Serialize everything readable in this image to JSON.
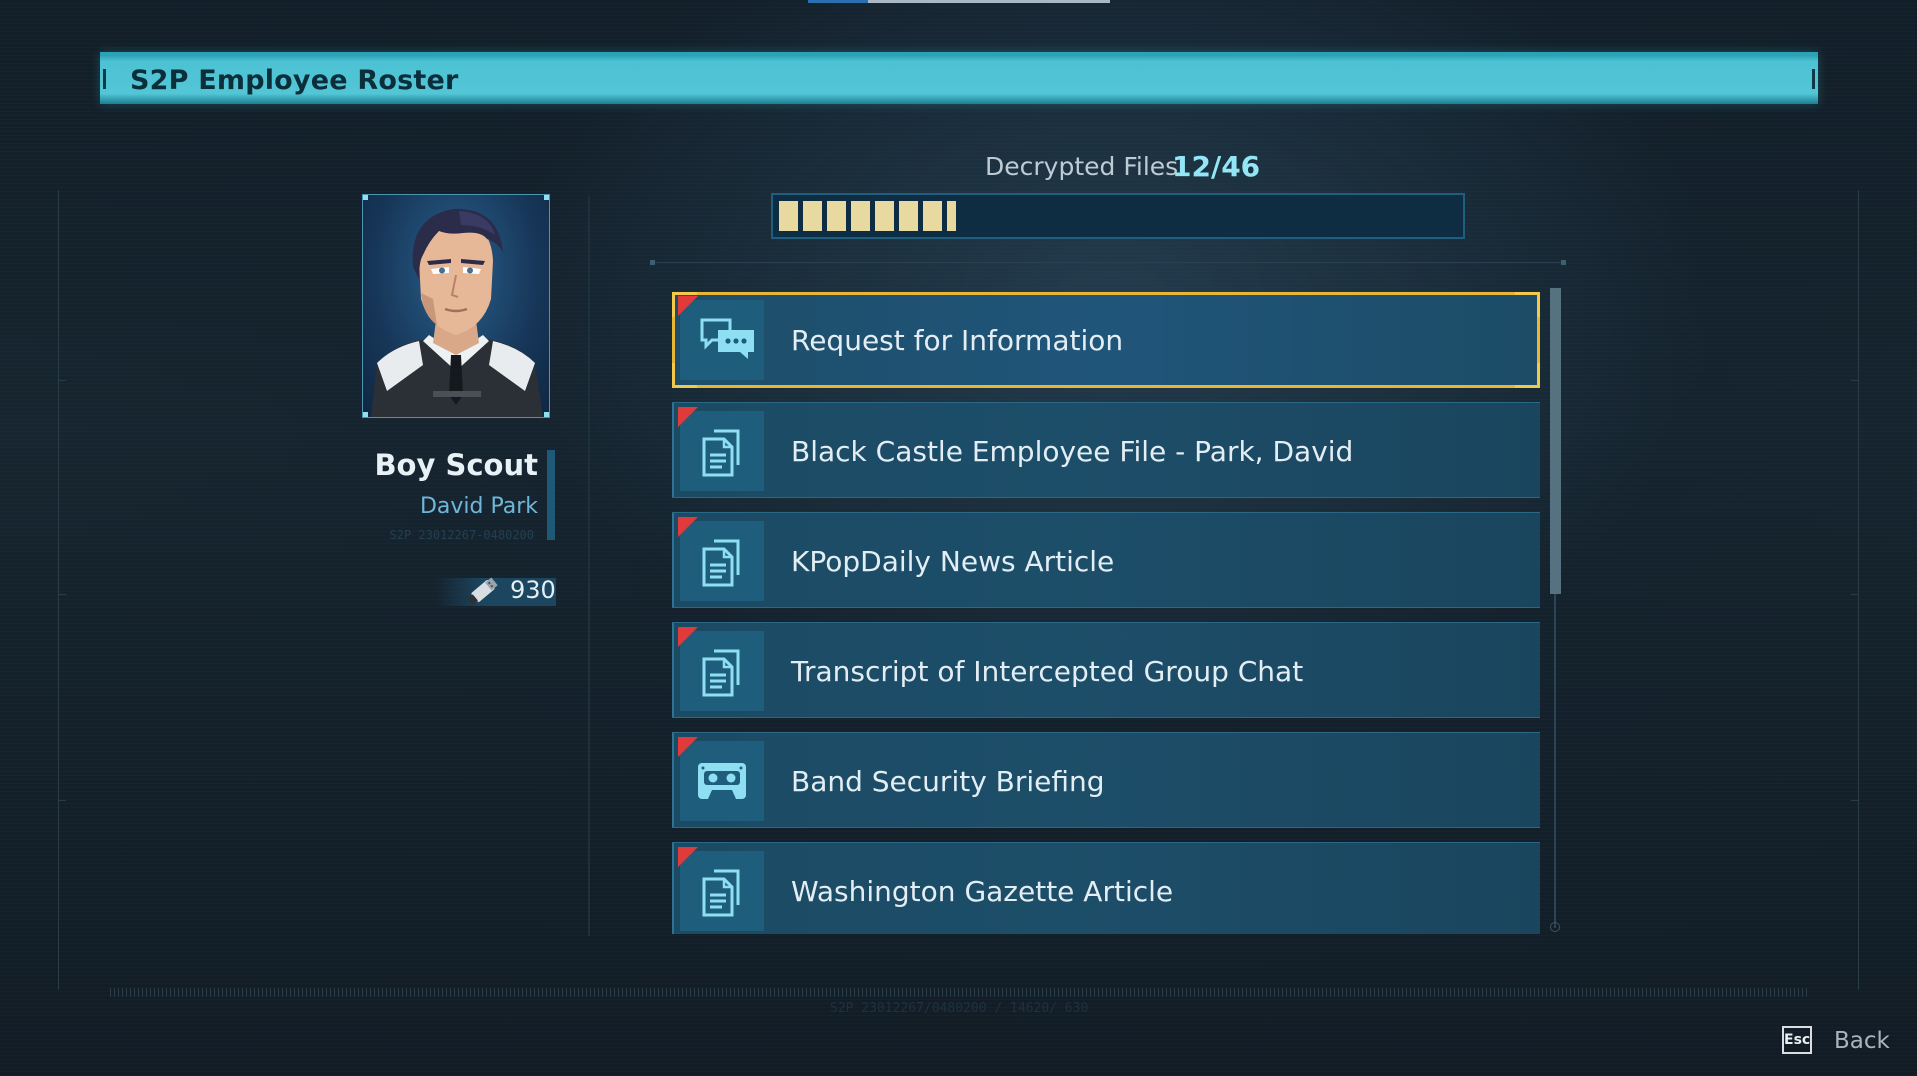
{
  "header": {
    "title": "S2P Employee Roster"
  },
  "profile": {
    "alias": "Boy Scout",
    "real_name": "David Park",
    "employee_code": "S2P 23012267-0480200",
    "currency_icon": "usb-drive-icon",
    "currency_value": "930"
  },
  "decryption": {
    "label": "Decrypted Files",
    "count": "12/46",
    "decrypted": 12,
    "total": 46
  },
  "files": [
    {
      "title": "Request for Information",
      "icon": "chat-bubbles-icon",
      "selected": true,
      "new": true
    },
    {
      "title": "Black Castle Employee File - Park, David",
      "icon": "document-icon",
      "selected": false,
      "new": true
    },
    {
      "title": "KPopDaily News Article",
      "icon": "document-icon",
      "selected": false,
      "new": true
    },
    {
      "title": "Transcript of Intercepted Group Chat",
      "icon": "document-icon",
      "selected": false,
      "new": true
    },
    {
      "title": "Band Security Briefing",
      "icon": "cassette-tape-icon",
      "selected": false,
      "new": true
    },
    {
      "title": "Washington Gazette Article",
      "icon": "document-icon",
      "selected": false,
      "new": true
    }
  ],
  "footer": {
    "code": "S2P 23012267/0480200 / 14620/ 630",
    "esc_key": "Esc",
    "back_label": "Back"
  },
  "colors": {
    "header_bg": "#53c6d6",
    "selection_border": "#e6b634",
    "new_flag": "#e03a3a",
    "progress_fill": "#e8d9a0",
    "count_highlight": "#93e6f5"
  }
}
